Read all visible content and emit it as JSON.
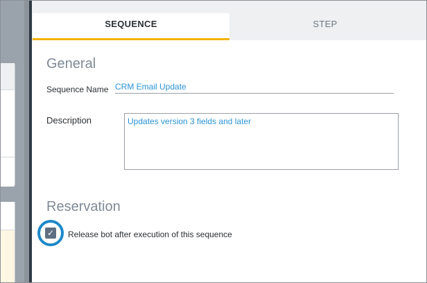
{
  "tabs": [
    {
      "label": "SEQUENCE",
      "active": true
    },
    {
      "label": "STEP",
      "active": false
    }
  ],
  "general": {
    "heading": "General",
    "sequence_name_label": "Sequence Name",
    "sequence_name_value": "CRM Email Update",
    "description_label": "Description",
    "description_value": "Updates version 3 fields and later"
  },
  "reservation": {
    "heading": "Reservation",
    "release_bot_label": "Release bot after execution of this sequence",
    "release_bot_checked": true
  },
  "icons": {
    "checkbox_check": "check-icon"
  },
  "colors": {
    "active_tab_underline": "#f2b200",
    "value_text": "#2a93d5",
    "highlight_ring": "#1e88c9",
    "checkbox_fill": "#5f6f82"
  }
}
